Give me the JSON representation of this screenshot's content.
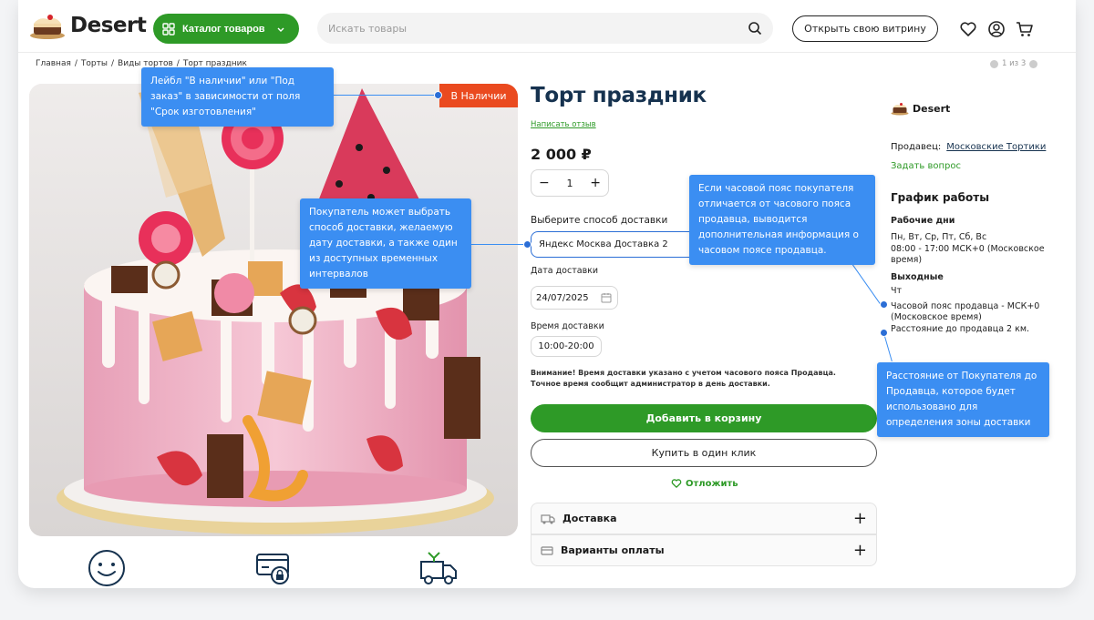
{
  "header": {
    "logo_text": "Desert",
    "catalog_label": "Каталог товаров",
    "search_placeholder": "Искать товары",
    "store_button": "Открыть свою витрину"
  },
  "breadcrumbs": [
    "Главная",
    "/",
    "Торты",
    "/",
    "Виды тортов",
    "/",
    "Торт праздник"
  ],
  "pager": "1 из 3",
  "product": {
    "stock_badge": "В Наличии",
    "title": "Торт праздник",
    "review_link": "Написать отзыв",
    "price": "2 000 ₽",
    "quantity": "1",
    "minus": "−",
    "plus": "+",
    "delivery_label": "Выберите способ доставки",
    "delivery_value": "Яндекс Москва Доставка 2",
    "date_label": "Дата доставки",
    "date_value": "24/07/2025",
    "time_label": "Время доставки",
    "time_value": "10:00-20:00",
    "notice_line1": "Внимание! Время доставки указано с учетом часового пояса Продавца.",
    "notice_line2": "Точное время сообщит администратор в день доставки.",
    "cart_button": "Добавить в корзину",
    "oneclick_button": "Купить в один клик",
    "defer_link": "Отложить",
    "accordion_delivery": "Доставка",
    "accordion_payment": "Варианты оплаты"
  },
  "seller": {
    "logo_text": "Desert",
    "seller_label": "Продавец:",
    "seller_name": "Московские Тортики",
    "ask_link": "Задать вопрос",
    "schedule_title": "График работы",
    "workdays_title": "Рабочие дни",
    "workdays_days": "Пн, Вт, Ср, Пт, Сб, Вс",
    "workdays_hours": "08:00 - 17:00 МСК+0 (Московское время)",
    "weekends_title": "Выходные",
    "weekends_days": "Чт",
    "timezone": "Часовой пояс продавца - МСК+0 (Московское время)",
    "distance": "Расстояние до продавца 2 км."
  },
  "callouts": {
    "stock": "Лейбл \"В наличии\" или \"Под заказ\" в зависимости от поля \"Срок изготовления\"",
    "delivery": "Покупатель может выбрать способ доставки, желаемую дату доставки, а также один из доступных временных интервалов",
    "timezone": "Если часовой пояс покупателя отличается от часового пояса продавца, выводится дополнительная информация о часовом поясе продавца.",
    "distance": "Расстояние от Покупателя до Продавца, которое будет использовано для определения зоны доставки"
  },
  "colors": {
    "brand_green": "#2e9a27",
    "badge_orange": "#ea4a1f",
    "callout_blue": "#3b8ef2",
    "title_navy": "#16324f"
  },
  "icons": [
    "grid-icon",
    "chevron-down-icon",
    "search-icon",
    "heart-icon",
    "user-icon",
    "cart-icon",
    "calendar-icon",
    "truck-icon",
    "card-icon",
    "smile-icon",
    "secure-card-icon",
    "delivery-truck-icon"
  ]
}
